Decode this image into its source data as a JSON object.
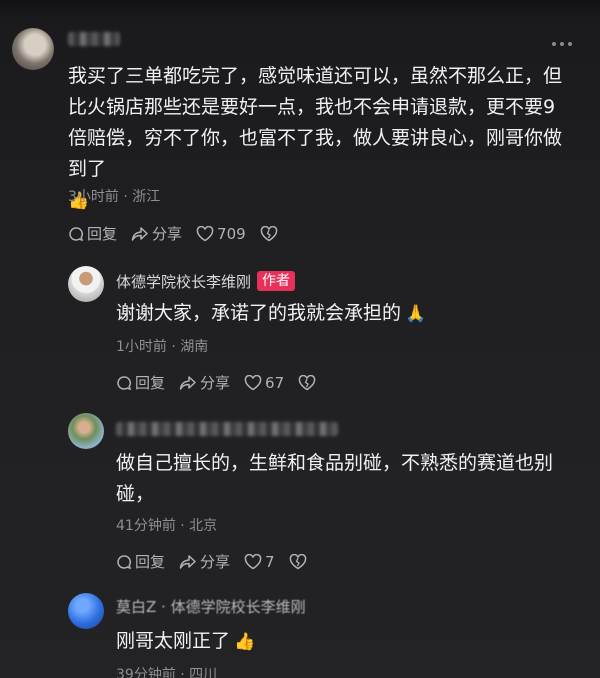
{
  "comments": [
    {
      "name": "",
      "text": "我买了三单都吃完了，感觉味道还可以，虽然不那么正，但比火锅店那些还是要好一点，我也不会申请退款，更不要9倍赔偿，穷不了你，也富不了我，做人要讲良心，刚哥你做到了",
      "emoji": "👍",
      "meta": "3小时前 · 浙江",
      "reply_label": "回复",
      "share_label": "分享",
      "likes": "709"
    },
    {
      "name": "体德学院校长李维刚",
      "badge": "作者",
      "text": "谢谢大家，承诺了的我就会承担的",
      "emoji": "🙏",
      "meta": "1小时前 · 湖南",
      "reply_label": "回复",
      "share_label": "分享",
      "likes": "67"
    },
    {
      "name": "",
      "text": "做自己擅长的，生鲜和食品别碰，不熟悉的赛道也别碰，",
      "meta": "41分钟前 · 北京",
      "reply_label": "回复",
      "share_label": "分享",
      "likes": "7"
    },
    {
      "name": "莫白Z · 体德学院校长李维刚",
      "text": "刚哥太刚正了",
      "emoji": "👍",
      "meta": "39分钟前 · 四川"
    }
  ],
  "icons": {
    "more": "more-icon",
    "reply": "reply-icon",
    "share": "share-icon",
    "like": "heart-icon",
    "dislike": "broken-heart-icon"
  },
  "colors": {
    "background": "#1e1e20",
    "author_badge": "#e7305a",
    "meta": "#8e8e93"
  }
}
